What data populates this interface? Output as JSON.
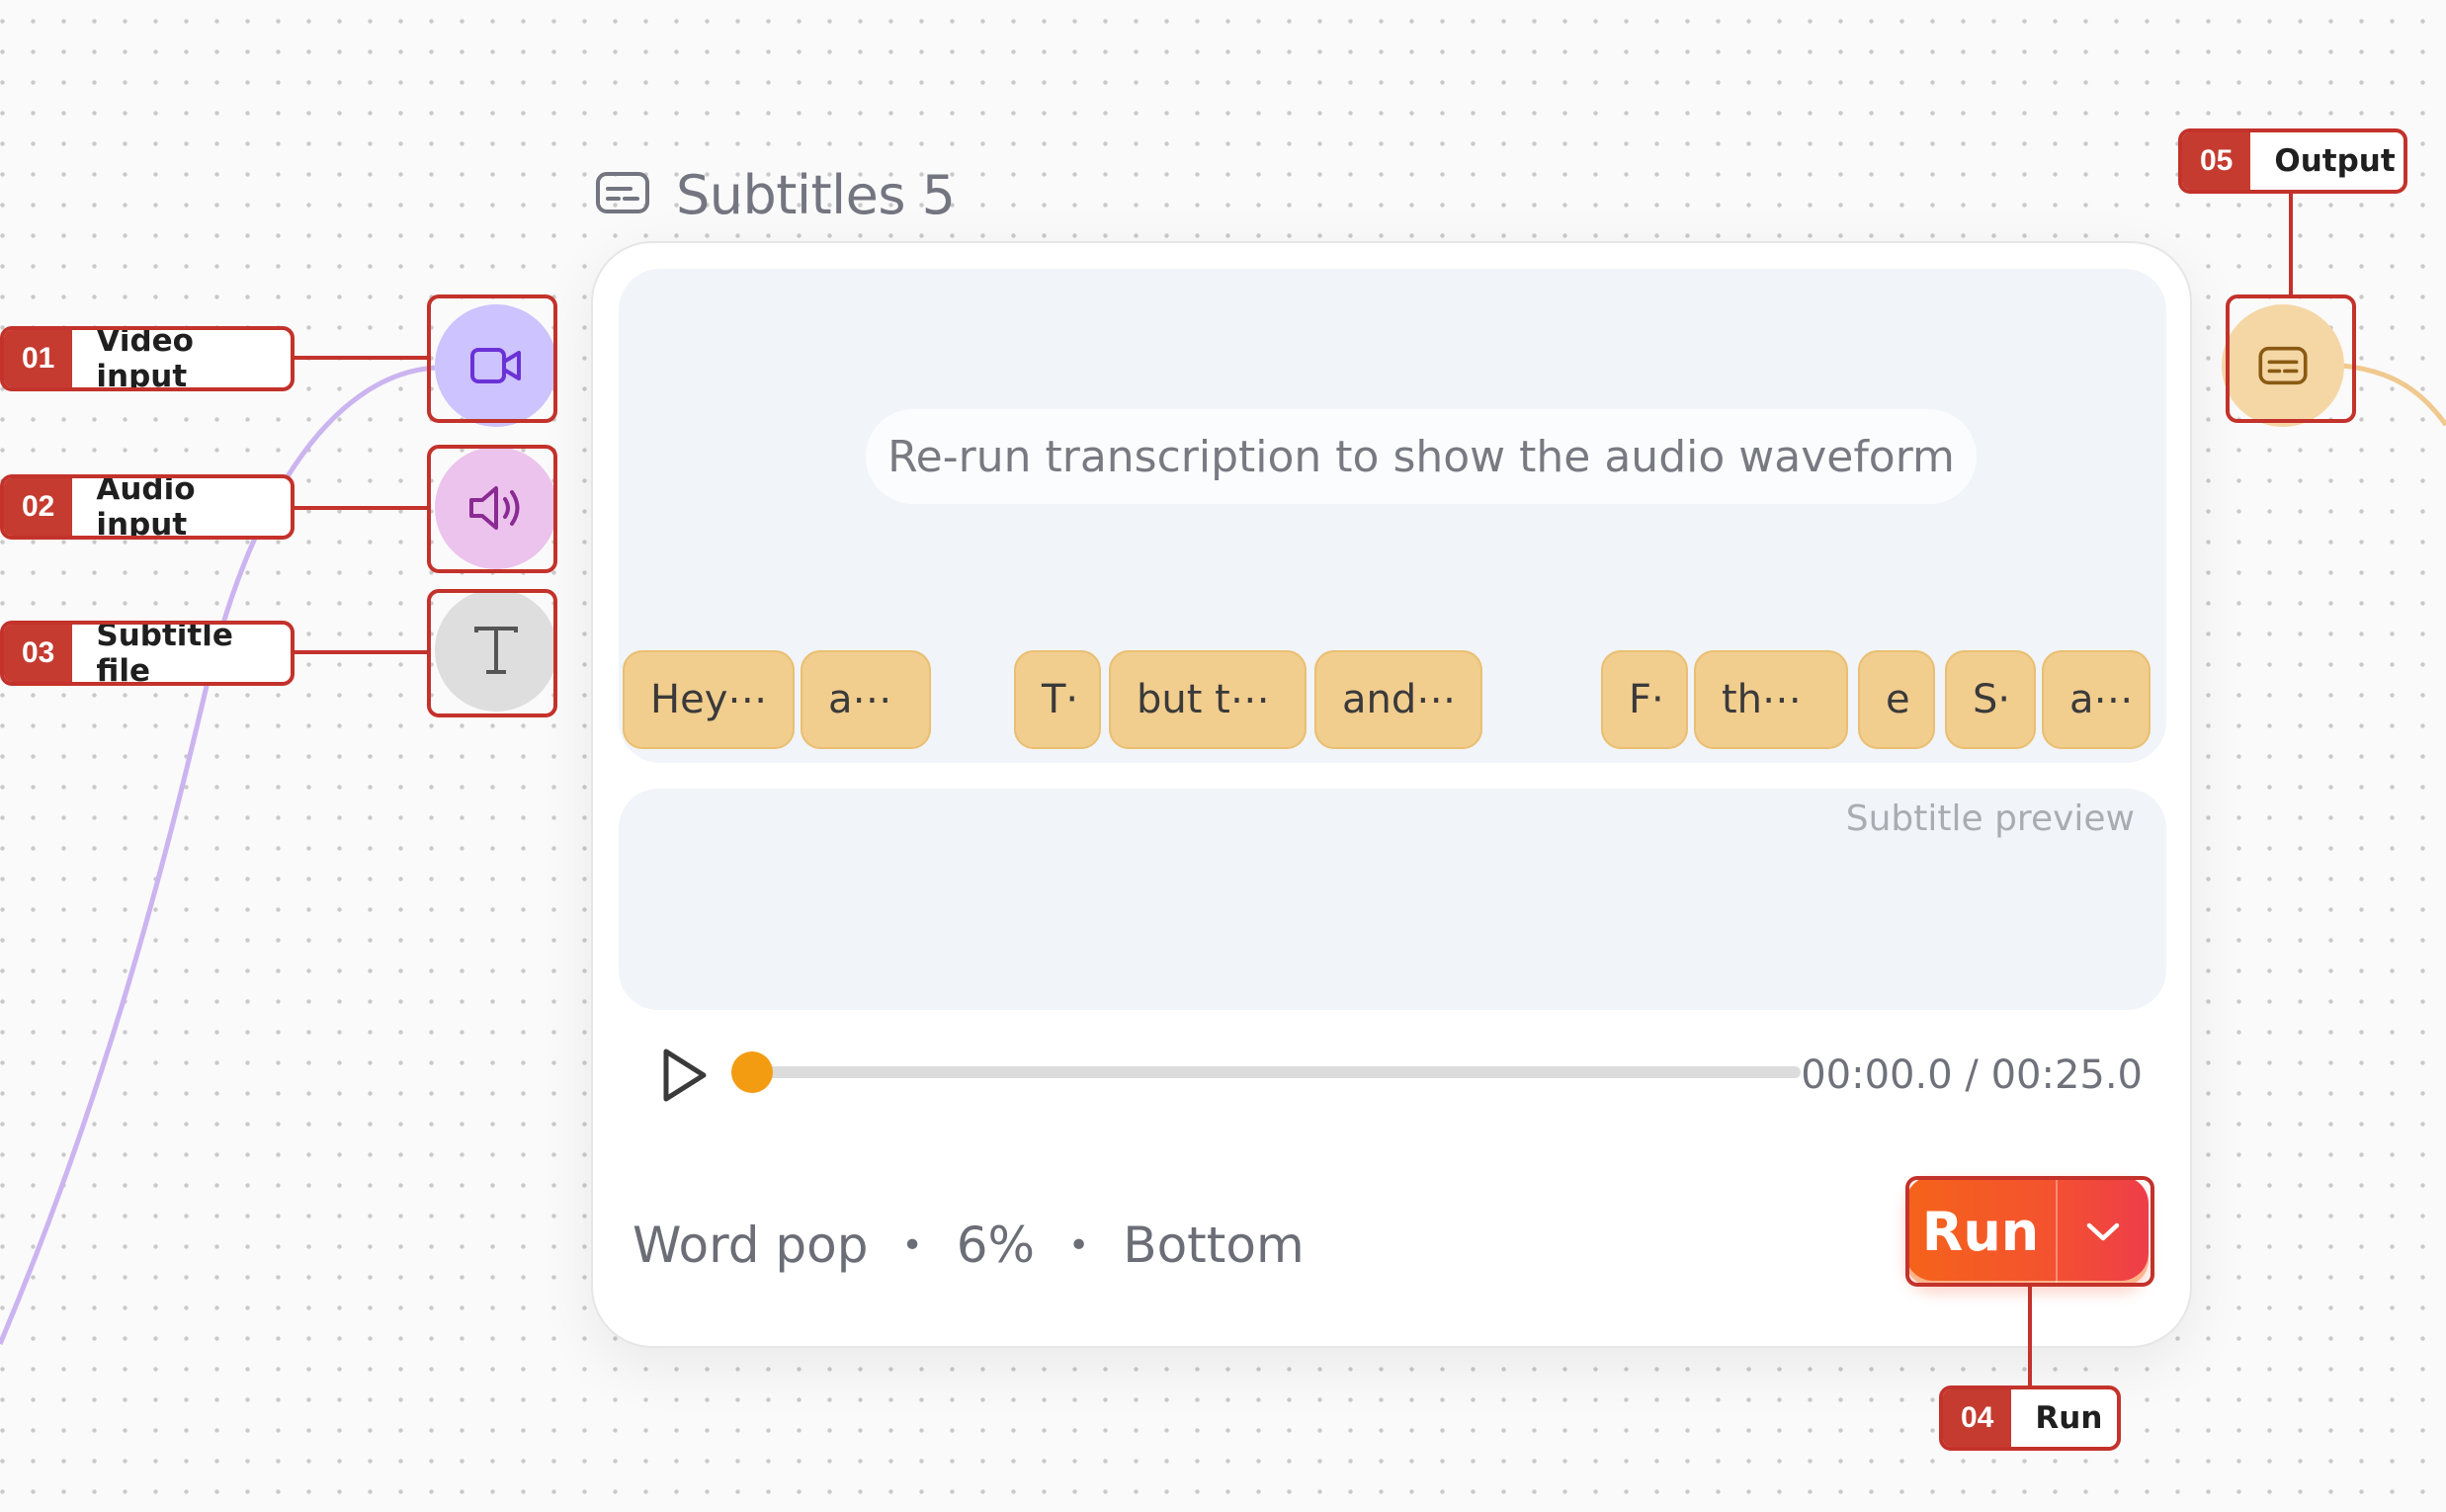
{
  "node": {
    "title": "Subtitles 5",
    "title_icon": "subtitles-icon",
    "waveform_hint": "Re-run transcription to show the audio waveform",
    "word_chips": [
      "Hey⋯",
      "a⋯",
      "T·",
      "but t⋯",
      "and⋯",
      "F·",
      "th⋯",
      "e",
      "S·",
      "a⋯"
    ],
    "preview_label": "Subtitle preview",
    "time_display": "00:00.0 / 00:25.0",
    "playback_progress": 0,
    "settings": {
      "style": "Word pop",
      "size": "6%",
      "position": "Bottom"
    },
    "run_label": "Run"
  },
  "ports": {
    "inputs": [
      {
        "icon": "video-camera-icon",
        "color": "#ccc3ff"
      },
      {
        "icon": "speaker-icon",
        "color": "#ecc3ec"
      },
      {
        "icon": "text-t-icon",
        "color": "#dedede"
      }
    ],
    "output": {
      "icon": "subtitles-icon",
      "color": "#f5d7a6"
    }
  },
  "annotations": [
    {
      "num": "01",
      "label": "Video input"
    },
    {
      "num": "02",
      "label": "Audio input"
    },
    {
      "num": "03",
      "label": "Subtitle file"
    },
    {
      "num": "04",
      "label": "Run"
    },
    {
      "num": "05",
      "label": "Output"
    }
  ],
  "colors": {
    "accent_red": "#c3322b",
    "run_gradient_start": "#f5631a",
    "run_gradient_end": "#ee3d4a",
    "chip_fill": "#f1cd8e",
    "wire_purple": "#cbb4f0",
    "wire_orange": "#f0c98f"
  }
}
